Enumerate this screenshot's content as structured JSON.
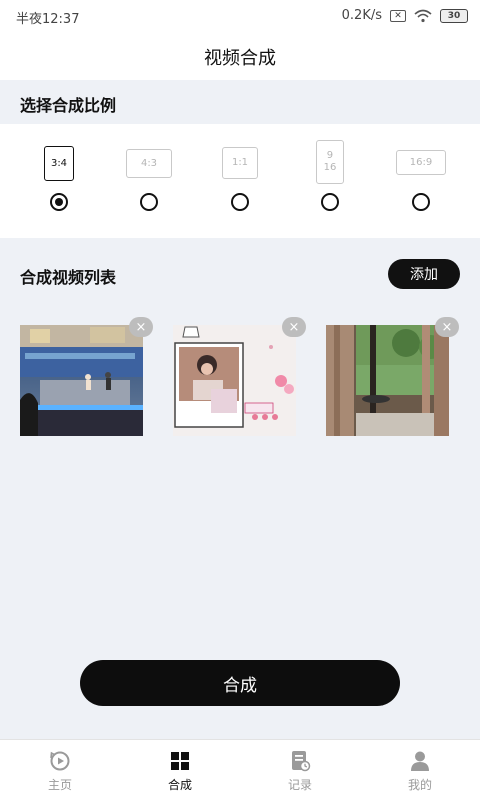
{
  "status_bar": {
    "time": "半夜12:37",
    "speed": "0.2K/s",
    "battery": "30"
  },
  "page_title": "视频合成",
  "ratio_section": {
    "title": "选择合成比例",
    "options": [
      {
        "label": "3:4",
        "selected": true
      },
      {
        "label": "4:3",
        "selected": false
      },
      {
        "label": "1:1",
        "selected": false
      },
      {
        "label": "9\n16",
        "selected": false
      },
      {
        "label": "16:9",
        "selected": false
      }
    ]
  },
  "video_list": {
    "title": "合成视频列表",
    "add_label": "添加",
    "close_symbol": "×"
  },
  "compose_label": "合成",
  "tabs": [
    {
      "label": "主页",
      "icon": "play-history-icon",
      "active": false
    },
    {
      "label": "合成",
      "icon": "grid-icon",
      "active": true
    },
    {
      "label": "记录",
      "icon": "document-icon",
      "active": false
    },
    {
      "label": "我的",
      "icon": "user-icon",
      "active": false
    }
  ],
  "colors": {
    "accent": "#111111",
    "background": "#eef1f6",
    "inactive": "#9a9a9a"
  }
}
